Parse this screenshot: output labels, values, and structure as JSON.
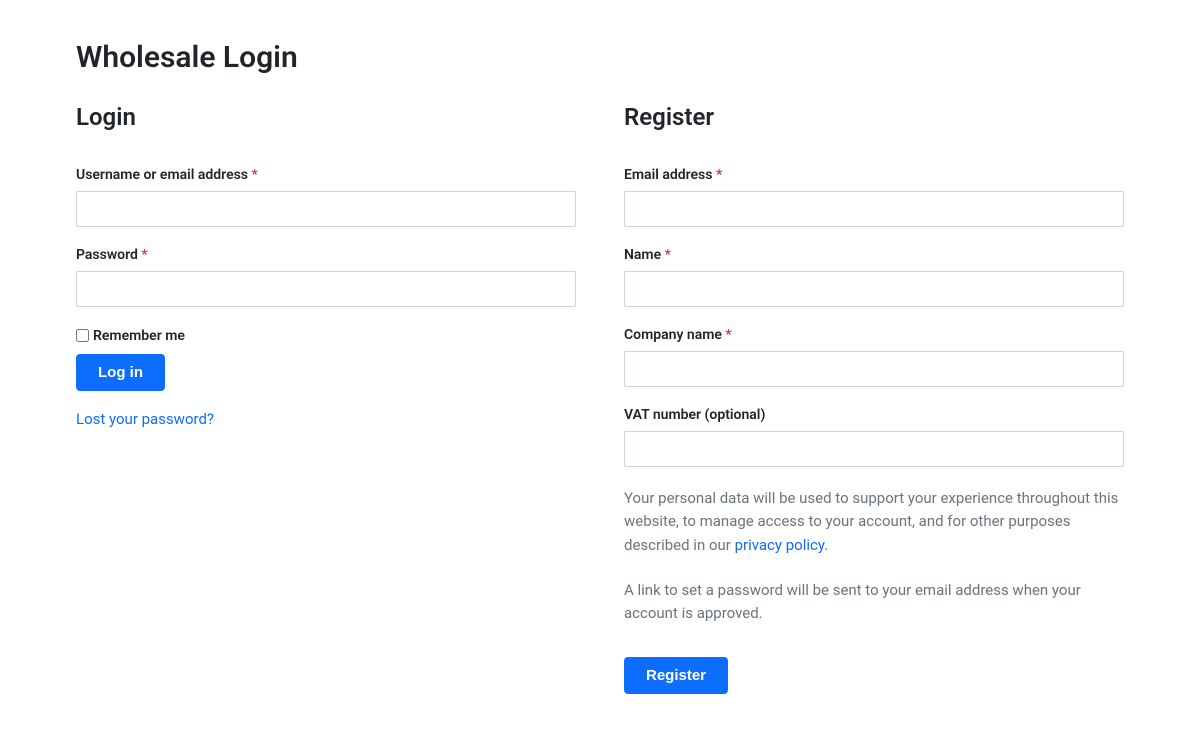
{
  "page_title": "Wholesale Login",
  "login": {
    "heading": "Login",
    "username_label": "Username or email address ",
    "password_label": "Password ",
    "remember_label": "Remember me",
    "button_label": "Log in",
    "lost_password_label": "Lost your password?",
    "required_mark": "*"
  },
  "register": {
    "heading": "Register",
    "email_label": "Email address ",
    "name_label": "Name ",
    "company_label": "Company name ",
    "vat_label": "VAT number (optional)",
    "privacy_text_1": "Your personal data will be used to support your experience throughout this website, to manage access to your account, and for other purposes described in our ",
    "privacy_link_label": "privacy policy",
    "privacy_text_2": ".",
    "password_info": "A link to set a password will be sent to your email address when your account is approved.",
    "button_label": "Register",
    "required_mark": "*"
  }
}
